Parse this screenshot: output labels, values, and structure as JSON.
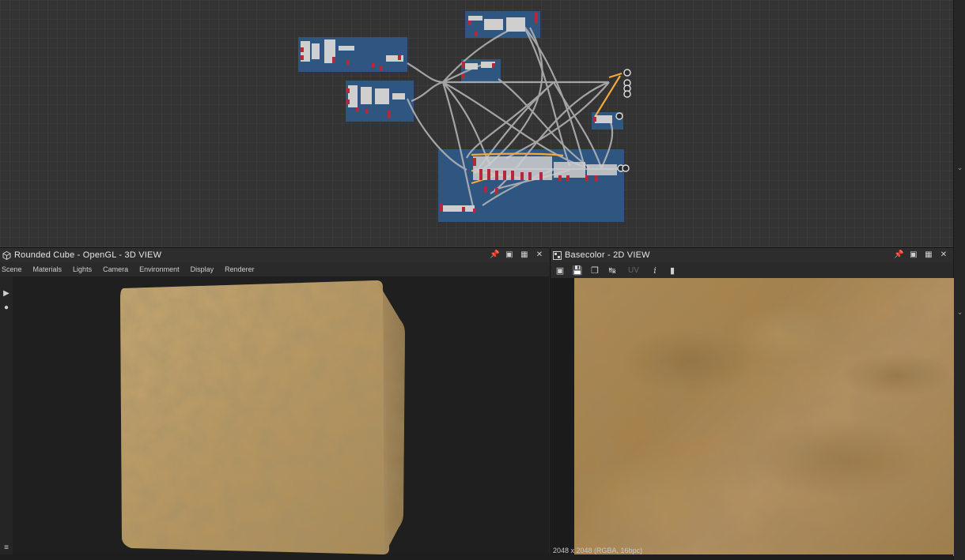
{
  "graph": {
    "frame_color": "#2e5a8a",
    "node_color": "#c8c8c8",
    "connector_color": "#b8b8b8",
    "highlight_connector_color": "#f2a93b",
    "port_color": "#b3283a"
  },
  "panel_3d": {
    "title": "Rounded Cube - OpenGL - 3D VIEW",
    "icon": "cube-icon",
    "menu": [
      "Scene",
      "Materials",
      "Lights",
      "Camera",
      "Environment",
      "Display",
      "Renderer"
    ]
  },
  "panel_2d": {
    "title": "Basecolor - 2D VIEW",
    "icon": "image-icon",
    "uv_label": "UV",
    "resolution": "2048 x 2048 (RGBA, 16bpc)"
  },
  "texture": {
    "base_color": "#b08a52"
  },
  "window_controls": [
    "pin-icon",
    "restore-icon",
    "maximize-icon",
    "close-icon"
  ]
}
